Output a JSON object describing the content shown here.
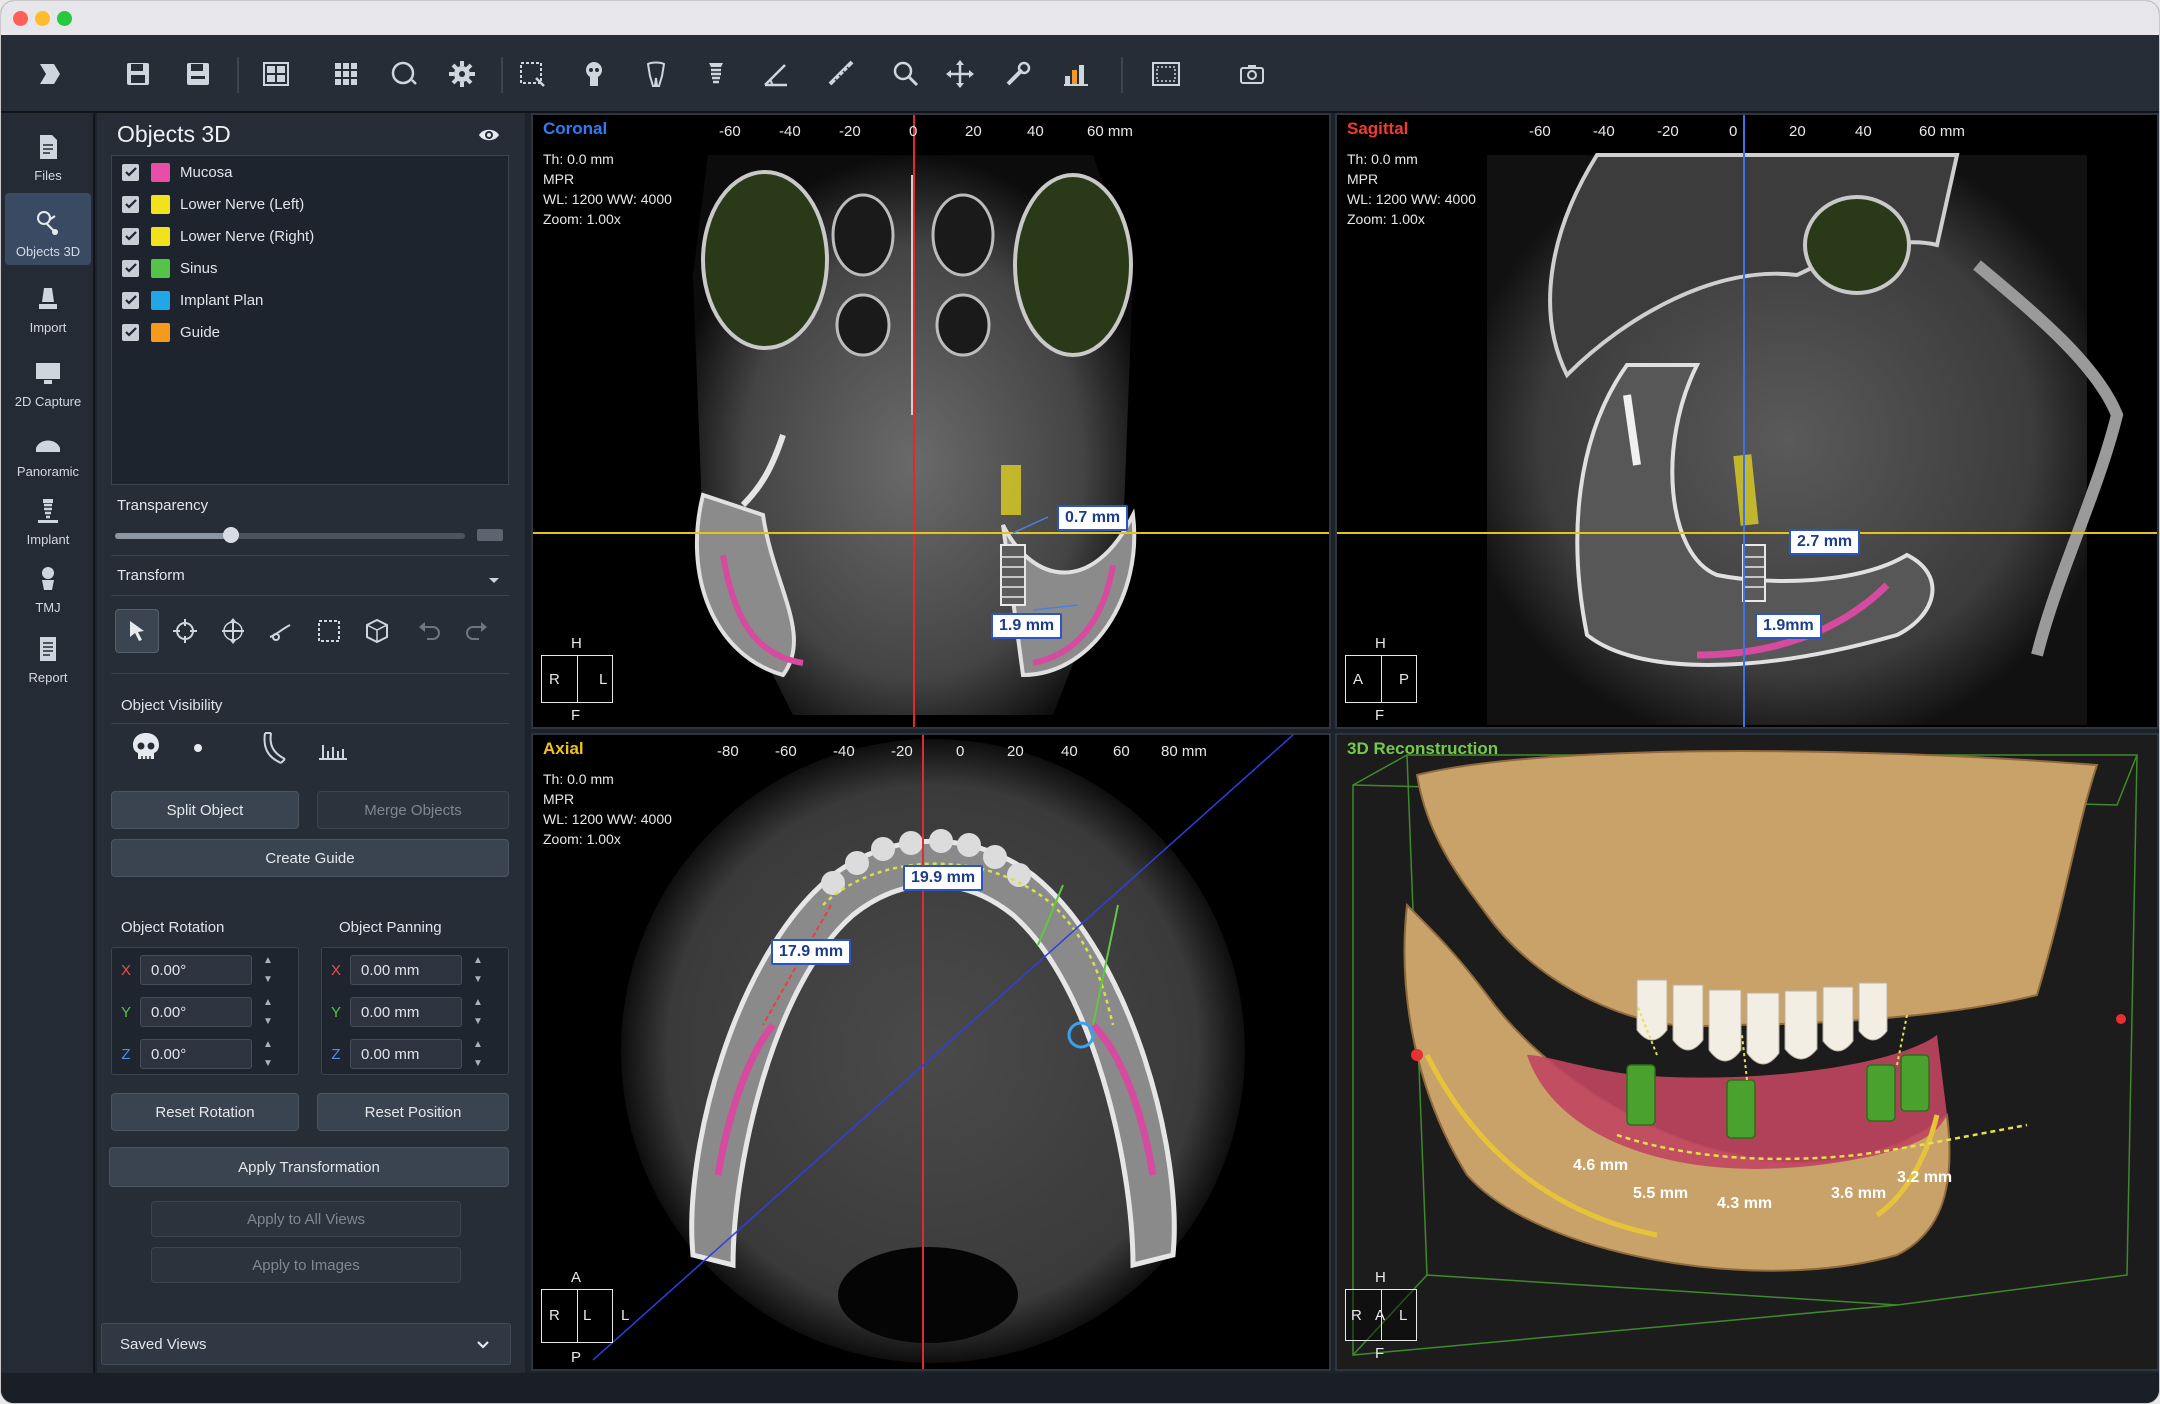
{
  "toolbar": {
    "icons": [
      "open-icon",
      "save-icon",
      "save-as-icon",
      "layout-icon",
      "grid-icon",
      "circle-icon",
      "settings-icon",
      "crop-icon",
      "skull-icon",
      "tooth-crown-icon",
      "implant-icon",
      "angle-icon",
      "ruler-icon",
      "zoom-icon",
      "pan-icon",
      "wrench-icon",
      "chart-icon",
      "screen-icon",
      "camera-icon"
    ]
  },
  "nav": {
    "items": [
      {
        "label": "Files",
        "icon": "files-icon"
      },
      {
        "label": "Objects 3D",
        "icon": "objects-3d-icon"
      },
      {
        "label": "Import",
        "icon": "import-icon"
      },
      {
        "label": "2D Capture",
        "icon": "monitor-icon"
      },
      {
        "label": "Panoramic",
        "icon": "panoramic-icon"
      },
      {
        "label": "Implant",
        "icon": "implant-icon"
      },
      {
        "label": "TMJ",
        "icon": "tmj-icon"
      },
      {
        "label": "Report",
        "icon": "report-icon"
      }
    ]
  },
  "panel": {
    "title": "Objects 3D",
    "objects": [
      {
        "label": "Mucosa",
        "color": "#e84ea8"
      },
      {
        "label": "Lower Nerve (Left)",
        "color": "#f2e21c"
      },
      {
        "label": "Lower Nerve (Right)",
        "color": "#f2e21c"
      },
      {
        "label": "Sinus",
        "color": "#55c24a"
      },
      {
        "label": "Implant Plan",
        "color": "#1fa7e8"
      },
      {
        "label": "Guide",
        "color": "#f59a1a"
      }
    ],
    "transparency_label": "Transparency",
    "transparency_value": 0.33,
    "transform_label": "Transform",
    "visibility_label": "Object Visibility",
    "split_object": "Split Object",
    "merge_objects": "Merge Objects",
    "create_guide": "Create Guide",
    "rotation_label": "Object Rotation",
    "panning_label": "Object Panning",
    "rotation": [
      {
        "axis": "X",
        "value": "0.00°"
      },
      {
        "axis": "Y",
        "value": "0.00°"
      },
      {
        "axis": "Z",
        "value": "0.00°"
      }
    ],
    "panning": [
      {
        "axis": "X",
        "value": "0.00 mm"
      },
      {
        "axis": "Y",
        "value": "0.00 mm"
      },
      {
        "axis": "Z",
        "value": "0.00 mm"
      }
    ],
    "reset_rotation": "Reset Rotation",
    "reset_position": "Reset Position",
    "apply_transformation": "Apply Transformation",
    "apply_all_views": "Apply to All Views",
    "apply_images": "Apply to Images",
    "saved_views": "Saved Views"
  },
  "views": {
    "coronal": {
      "title": "Coronal",
      "title_color": "#2f7cf6",
      "info": [
        "Th: 0.0 mm",
        "MPR",
        "WL: 1200  WW: 4000",
        "Zoom: 1.00x"
      ],
      "ruler": [
        "-60",
        "-40",
        "-20",
        "0",
        "20",
        "40",
        "60 mm"
      ],
      "measurements": [
        "0.7 mm",
        "1.9 mm"
      ],
      "orient": {
        "top": "H",
        "left": "R",
        "right": "L",
        "bottom": "F"
      }
    },
    "sagittal": {
      "title": "Sagittal",
      "title_color": "#f23a2f",
      "info": [
        "Th: 0.0 mm",
        "MPR",
        "WL: 1200  WW: 4000",
        "Zoom: 1.00x"
      ],
      "ruler": [
        "-60",
        "-40",
        "-20",
        "0",
        "20",
        "40",
        "60 mm"
      ],
      "measurements": [
        "2.7 mm",
        "1.9mm"
      ],
      "orient": {
        "top": "H",
        "left": "A",
        "right": "P",
        "bottom": "F"
      }
    },
    "axial": {
      "title": "Axial",
      "title_color": "#f2c21c",
      "info": [
        "Th: 0.0 mm",
        "MPR",
        "WL: 1200  WW: 4000",
        "Zoom: 1.00x"
      ],
      "ruler": [
        "-80",
        "-60",
        "-40",
        "-20",
        "0",
        "20",
        "40",
        "60",
        "80 mm"
      ],
      "measurements": [
        "19.9 mm",
        "17.9 mm"
      ],
      "orient": {
        "top": "A",
        "left": "R",
        "right": "L",
        "bottom": "P",
        "mid": "L"
      }
    },
    "recon": {
      "title": "3D Reconstruction",
      "title_color": "#74c94a",
      "measurements": [
        "4.6 mm",
        "5.5 mm",
        "4.3 mm",
        "3.6 mm",
        "3.2 mm"
      ],
      "orient": {
        "top": "H",
        "left": "R",
        "mid": "A",
        "right": "L",
        "bottom": "F"
      }
    }
  }
}
